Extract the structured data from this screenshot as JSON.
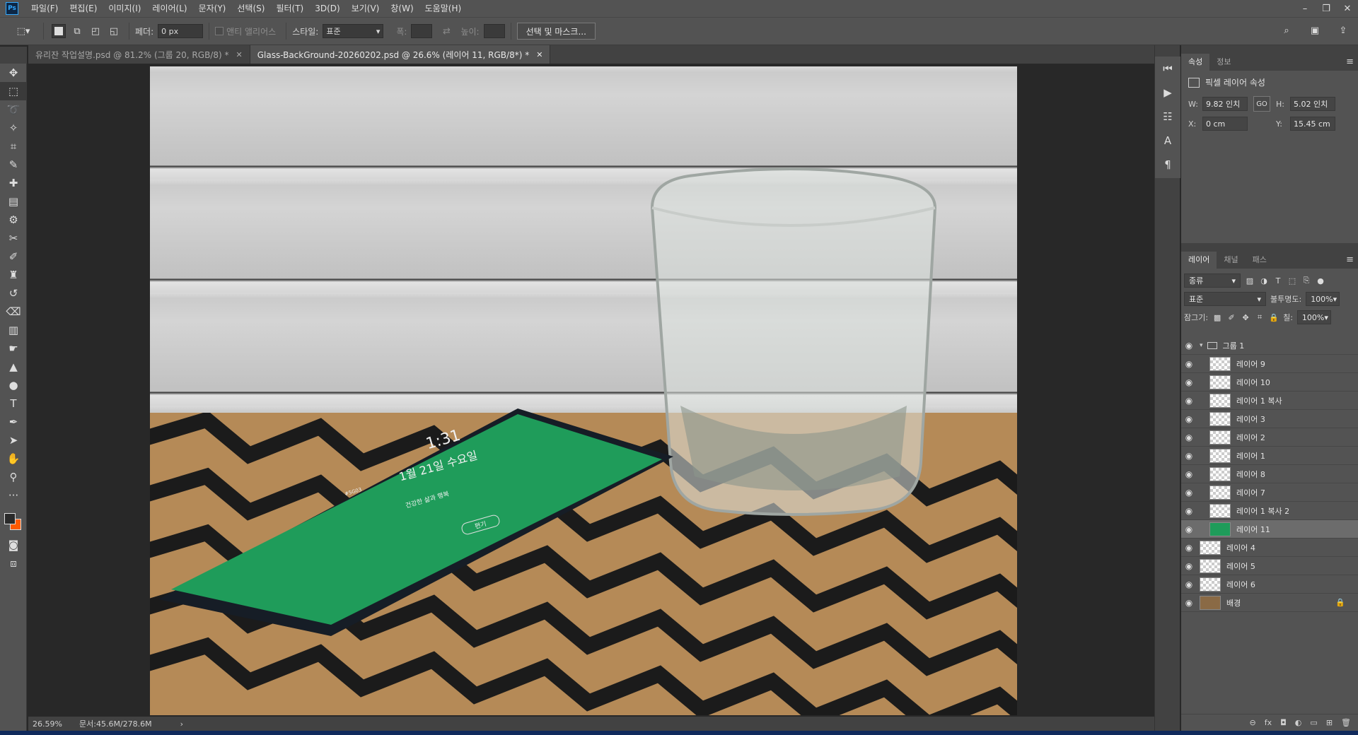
{
  "app": {
    "logo": "Ps",
    "menu": [
      "파일(F)",
      "편집(E)",
      "이미지(I)",
      "레이어(L)",
      "문자(Y)",
      "선택(S)",
      "필터(T)",
      "3D(D)",
      "보기(V)",
      "창(W)",
      "도움말(H)"
    ],
    "window_controls": [
      "–",
      "❐",
      "✕"
    ]
  },
  "options": {
    "feather_label": "페더:",
    "feather_value": "0 px",
    "antialias_label": "앤티 앨리어스",
    "style_label": "스타일:",
    "style_value": "표준",
    "width_label": "폭:",
    "height_label": "높이:",
    "select_mask_button": "선택 및 마스크..."
  },
  "tabs": [
    {
      "label": "유리잔 작업설명.psd @ 81.2% (그룹 20, RGB/8) *",
      "close": "✕"
    },
    {
      "label": "Glass-BackGround-20260202.psd @ 26.6% (레이어 11, RGB/8*) *",
      "close": "✕"
    }
  ],
  "phone": {
    "time": "1:31",
    "date": "1월 21일 수요일",
    "tagline": "건강한 삶과 행복",
    "button": "편기",
    "side": "#5G03"
  },
  "status": {
    "zoom": "26.59%",
    "doc": "문서:45.6M/278.6M",
    "arrow": "›"
  },
  "properties": {
    "tabs": [
      "속성",
      "정보"
    ],
    "title": "픽셀 레이어 속성",
    "w_label": "W:",
    "w_value": "9.82 인치",
    "h_label": "H:",
    "h_value": "5.02 인치",
    "x_label": "X:",
    "x_value": "0 cm",
    "y_label": "Y:",
    "y_value": "15.45 cm",
    "link_icon": "GO"
  },
  "layers_panel": {
    "tabs": [
      "레이어",
      "채널",
      "패스"
    ],
    "filter_kind": "종류",
    "blend_mode": "표준",
    "opacity_label": "불투명도:",
    "opacity_value": "100%",
    "lock_label": "잠그기:",
    "fill_label": "칠:",
    "fill_value": "100%",
    "group_name": "그룹 1",
    "layers": [
      "레이어 9",
      "레이어 10",
      "레이어 1 복사",
      "레이어 3",
      "레이어 2",
      "레이어 1",
      "레이어 8",
      "레이어 7",
      "레이어 1 복사 2",
      "레이어 11",
      "레이어 4",
      "레이어 5",
      "레이어 6",
      "배경"
    ],
    "selected": "레이어 11",
    "footer": [
      "⊖",
      "fx",
      "◘",
      "◐",
      "▭",
      "⊞",
      "🗑"
    ]
  }
}
